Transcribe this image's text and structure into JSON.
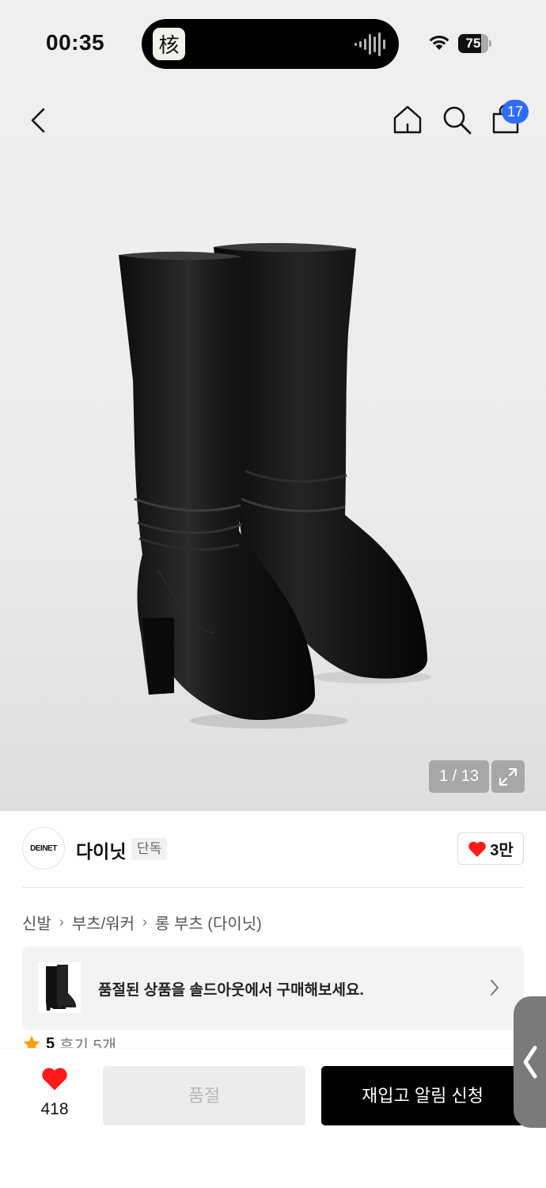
{
  "status_bar": {
    "time": "00:35",
    "island_app_icon": "calligraphy-app-icon",
    "island_app_glyph": "核",
    "wave_icon": "audio-wave-icon",
    "wifi_icon": "wifi-icon",
    "battery_level": "75",
    "battery_fraction": 0.75
  },
  "header": {
    "back_icon": "chevron-left-icon",
    "home_icon": "home-icon",
    "search_icon": "search-icon",
    "cart_icon": "shopping-bag-icon",
    "cart_count": "17",
    "badge_color": "#2f6bff"
  },
  "gallery": {
    "counter": "1 / 13",
    "expand_icon": "expand-icon"
  },
  "brand": {
    "logo_text": "DEINET",
    "name": "다이닛",
    "tag": "단독",
    "likes": "3만",
    "heart_color": "#ff1a1a"
  },
  "breadcrumb": {
    "items": [
      "신발",
      "부츠/워커",
      "롱 부츠 (다이닛)"
    ]
  },
  "soldout_banner": {
    "text": "품절된 상품을 솔드아웃에서 구매해보세요."
  },
  "review": {
    "score": "5",
    "label": "후기 5개",
    "star_color": "#ff9d00"
  },
  "bottom_bar": {
    "like_count": "418",
    "soldout_label": "품절",
    "restock_label": "재입고 알림 신청"
  }
}
